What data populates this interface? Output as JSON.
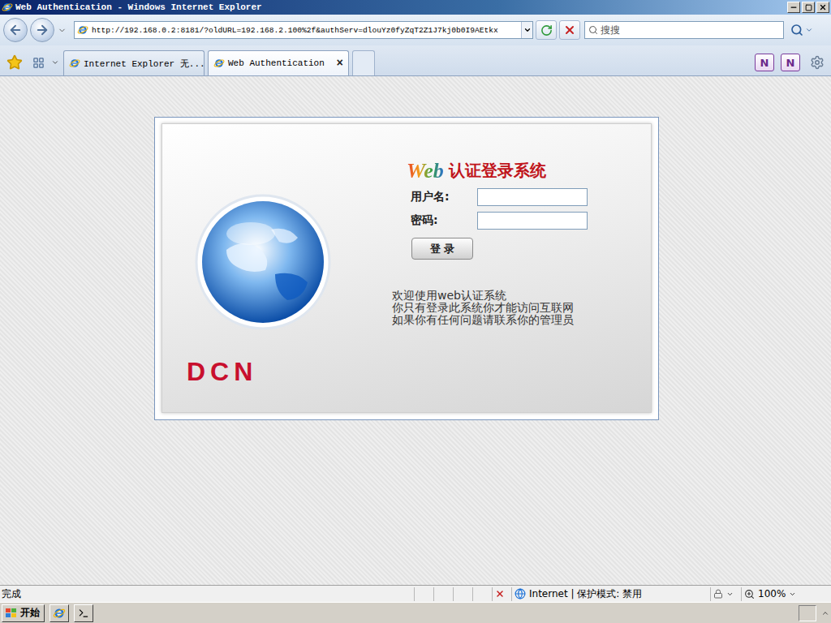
{
  "window": {
    "title": "Web Authentication - Windows Internet Explorer"
  },
  "address": {
    "url": "http://192.168.0.2:8181/?oldURL=192.168.2.100%2f&authServ=dlouYz0fyZqT2Z1J7kj0b0I9AEtkx"
  },
  "search": {
    "placeholder": "搜搜"
  },
  "tabs": [
    {
      "label": "Internet Explorer 无...",
      "selected": false,
      "closable": false
    },
    {
      "label": "Web Authentication",
      "selected": true,
      "closable": true
    }
  ],
  "tab_close": "×",
  "addons": [
    {
      "label": "N"
    },
    {
      "label": "N"
    }
  ],
  "login": {
    "logo": "Web",
    "title": "认证登录系统",
    "fields": [
      {
        "label": "用户名:",
        "value": "",
        "kind": "text"
      },
      {
        "label": "密码:",
        "value": "",
        "kind": "password"
      }
    ],
    "button": "登 录",
    "messages": [
      "欢迎使用web认证系统",
      "你只有登录此系统你才能访问互联网",
      "如果你有任何问题请联系你的管理员"
    ],
    "brand": "DCN"
  },
  "status_bar": {
    "text": "完成",
    "zone": "Internet | 保护模式: 禁用",
    "zoom": "100%"
  },
  "taskbar": {
    "start": "开始"
  }
}
